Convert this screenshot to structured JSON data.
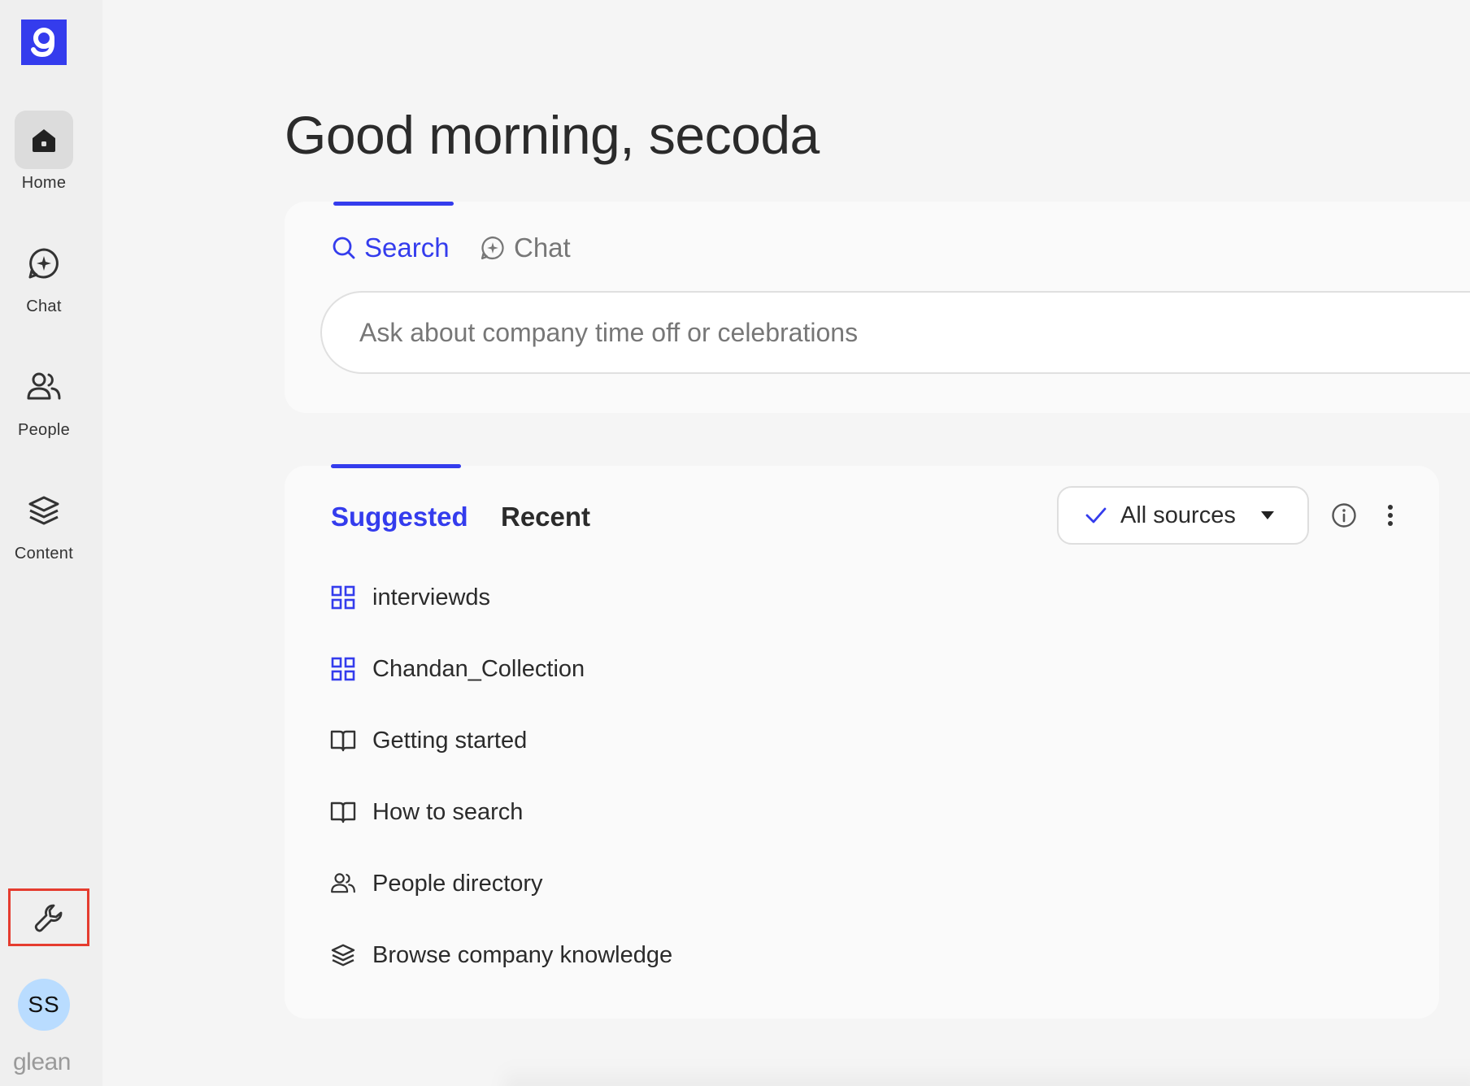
{
  "brand": {
    "logo_letter": "g",
    "wordmark": "glean",
    "color": "#343ced"
  },
  "sidebar": {
    "items": [
      {
        "label": "Home",
        "icon": "home-icon",
        "active": true
      },
      {
        "label": "Chat",
        "icon": "chat-sparkle-icon",
        "active": false
      },
      {
        "label": "People",
        "icon": "people-icon",
        "active": false
      },
      {
        "label": "Content",
        "icon": "layers-icon",
        "active": false
      }
    ],
    "tools_icon": "wrench-icon",
    "avatar_initials": "SS"
  },
  "greeting": "Good morning, secoda",
  "search_card": {
    "tabs": [
      {
        "label": "Search",
        "icon": "search-icon",
        "active": true
      },
      {
        "label": "Chat",
        "icon": "chat-sparkle-icon",
        "active": false
      }
    ],
    "input_placeholder": "Ask about company time off or celebrations",
    "input_value": ""
  },
  "suggestions_card": {
    "tabs": [
      {
        "label": "Suggested",
        "active": true
      },
      {
        "label": "Recent",
        "active": false
      }
    ],
    "sources_filter": {
      "label": "All sources",
      "checked": true
    },
    "items": [
      {
        "label": "interviewds",
        "icon": "collection-grid-icon"
      },
      {
        "label": "Chandan_Collection",
        "icon": "collection-grid-icon"
      },
      {
        "label": "Getting started",
        "icon": "book-icon"
      },
      {
        "label": "How to search",
        "icon": "book-icon"
      },
      {
        "label": "People directory",
        "icon": "people-icon"
      },
      {
        "label": "Browse company knowledge",
        "icon": "layers-icon"
      }
    ]
  },
  "colors": {
    "accent": "#343ced",
    "highlight_box": "#e53c2f",
    "avatar_bg": "#b9dcff"
  }
}
